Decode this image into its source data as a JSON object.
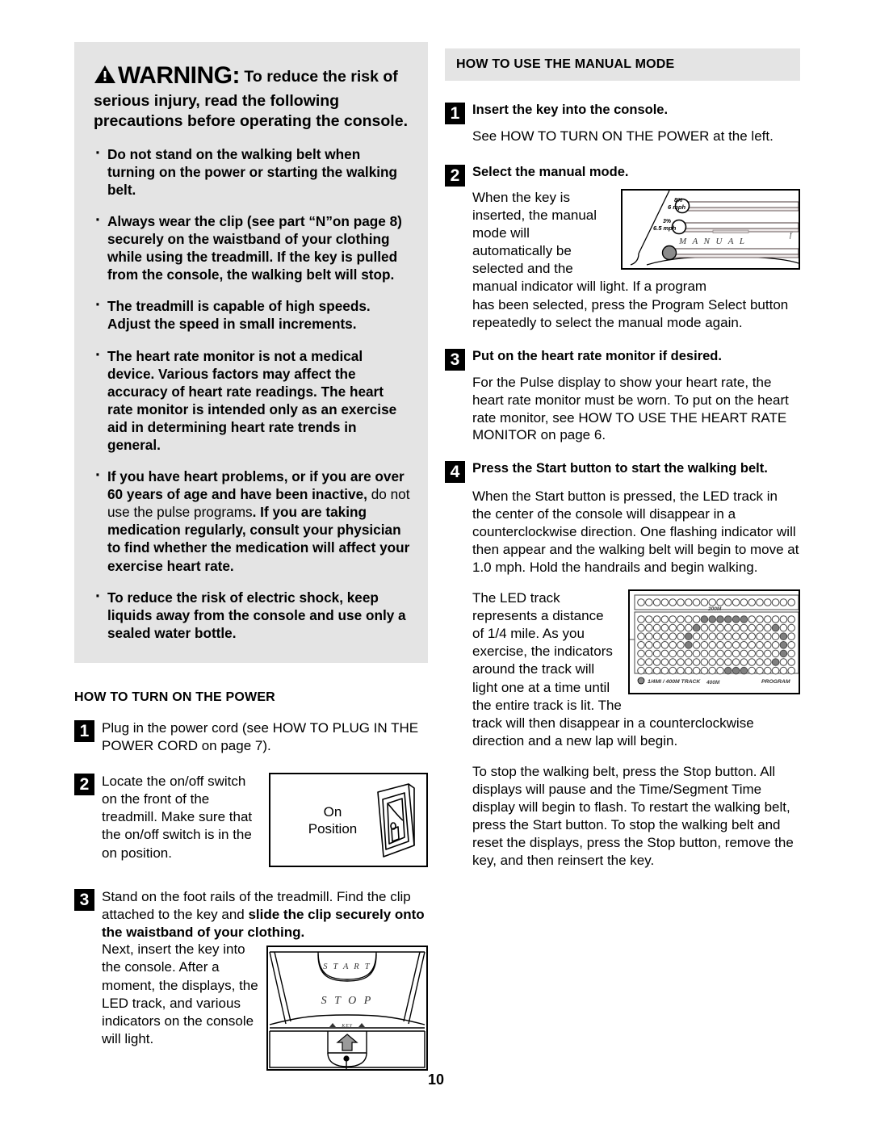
{
  "page_number": "10",
  "warning": {
    "label": "WARNING:",
    "headline_rest": "To reduce the risk of serious injury, read the following precautions before operating the console.",
    "bullets": [
      {
        "text": "Do not stand on the walking belt when turning on the power or starting the walking belt."
      },
      {
        "text": "Always wear the clip (see part “N”on page 8) securely on the waistband of your clothing while using the treadmill. If the key is pulled from the console, the walking belt will stop."
      },
      {
        "text": "The treadmill is capable of high speeds. Adjust the speed in small increments."
      },
      {
        "text": "The heart rate monitor is not a medical device. Various factors may affect the accuracy of heart rate readings. The heart rate monitor is intended only as an exercise aid in determining heart rate trends in general."
      },
      {
        "part1": "If you have heart problems, or if you are over 60 years of age and have been inactive,",
        "part2_regular": "do not use the pulse programs",
        "part3": ". If you are taking medication regularly, consult your physician to find whether the medication will affect your exercise heart rate."
      },
      {
        "text": "To reduce the risk of electric shock, keep liquids away from the console and use only a sealed water bottle."
      }
    ]
  },
  "power_section": {
    "heading": "HOW TO TURN ON THE POWER",
    "step1": {
      "number": "1",
      "text": "Plug in the power cord (see HOW TO PLUG IN THE POWER CORD on page 7)."
    },
    "step2": {
      "number": "2",
      "text": "Locate the on/off switch on the front of the treadmill. Make sure that the on/off switch is in the on position.",
      "figure": {
        "name": "on-off-switch-diagram",
        "label_line1": "On",
        "label_line2": "Position"
      }
    },
    "step3": {
      "number": "3",
      "text_regular_1": "Stand on the foot rails of the treadmill. Find the clip attached to the key and ",
      "text_bold": "slide the clip securely onto the waistband of your clothing.",
      "text_regular_2": "Next, insert the key into the console. After a moment, the displays, the LED track, and various indicators on the console will light.",
      "figure": {
        "name": "console-start-stop-diagram",
        "start_label": "S T A R T",
        "stop_label": "S T O P",
        "key_label": "KEY"
      }
    }
  },
  "manual_section": {
    "heading": "HOW TO USE THE MANUAL MODE",
    "step1": {
      "number": "1",
      "title": "Insert the key into the console.",
      "body": "See HOW TO TURN ON THE POWER at the left."
    },
    "step2": {
      "number": "2",
      "title": "Select the manual mode.",
      "body_wrap": "When the key is inserted, the manual mode will automatically be selected and the manual indicator will light. If a program",
      "body_full": "has been selected, press the Program Select button repeatedly to select the manual mode again.",
      "figure": {
        "name": "manual-mode-display-diagram",
        "incline_1": "8%",
        "speed_1": "6 mph",
        "incline_2": "3%",
        "speed_2": "6.5 mph",
        "mode_label": "M A N U A L",
        "edge_label": "f"
      }
    },
    "step3": {
      "number": "3",
      "title": "Put on the heart rate monitor if desired.",
      "body": "For the Pulse display to show your heart rate, the heart rate monitor must be worn. To put on the heart rate monitor, see HOW TO USE THE HEART RATE MONITOR on page 6."
    },
    "step4": {
      "number": "4",
      "title": "Press the Start button to start the walking belt.",
      "para1": "When the Start button is pressed, the LED track in the center of the console will disappear in a counterclockwise direction. One flashing indicator will then appear and the walking belt will begin to move at 1.0 mph. Hold the handrails and begin walking.",
      "para2_wrap": "The LED track represents a distance of 1/4 mile. As you exercise, the indicators around the track will light one at a time until the entire track is lit. The",
      "para2_full": "track will then disappear in a counterclockwise direction and a new lap will begin.",
      "para3": "To stop the walking belt, press the Stop button. All displays will pause and the Time/Segment Time display will begin to flash. To restart the walking belt, press the Start button. To stop the walking belt and reset the displays, press the Stop button, remove the key, and then reinsert the key.",
      "figure": {
        "name": "led-track-diagram",
        "label_200m": "200M",
        "label_400m": "400M",
        "label_track": "1/4MI / 400M TRACK",
        "label_program": "PROGRAM"
      }
    }
  },
  "colors": {
    "warning_bg": "#e4e4e4",
    "header_band_bg": "#e4e4e4",
    "step_marker_bg": "#000000",
    "led_lit": "#808080",
    "diagram_line": "#000000"
  }
}
